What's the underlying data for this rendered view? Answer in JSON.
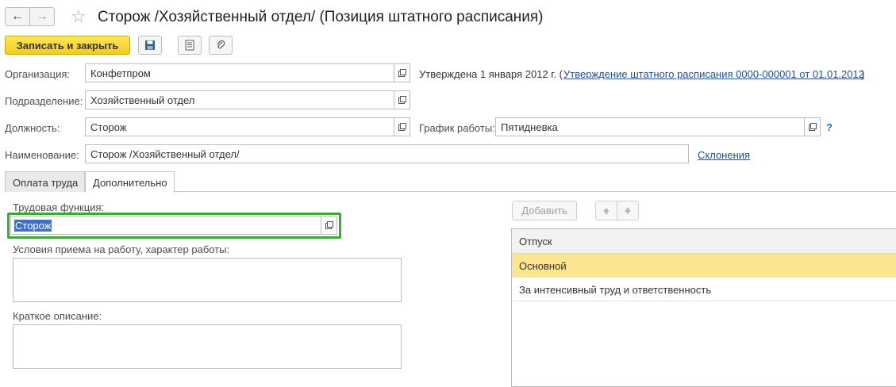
{
  "window": {
    "title": "Сторож /Хозяйственный отдел/ (Позиция штатного расписания)",
    "back_glyph": "←",
    "forward_glyph": "→",
    "star_glyph": "☆"
  },
  "toolbar": {
    "save_close_label": "Записать и закрыть"
  },
  "form": {
    "organization": {
      "label": "Организация:",
      "value": "Конфетпром"
    },
    "approved": {
      "text": "Утверждена 1 января 2012 г. (",
      "link": "Утверждение штатного расписания 0000-000001 от 01.01.2012",
      "close": ")"
    },
    "department": {
      "label": "Подразделение:",
      "value": "Хозяйственный отдел"
    },
    "position": {
      "label": "Должность:",
      "value": "Сторож"
    },
    "schedule": {
      "label": "График работы:",
      "value": "Пятидневка",
      "help": "?"
    },
    "name": {
      "label": "Наименование:",
      "value": "Сторож /Хозяйственный отдел/",
      "declension_link": "Склонения"
    }
  },
  "tabs": [
    {
      "label": "Оплата труда",
      "active": false
    },
    {
      "label": "Дополнительно",
      "active": true
    }
  ],
  "additional": {
    "labor_function": {
      "label": "Трудовая функция:",
      "value": "Сторож"
    },
    "conditions": {
      "label": "Условия приема на работу, характер работы:",
      "value": ""
    },
    "short_description": {
      "label": "Краткое описание:",
      "value": ""
    }
  },
  "vacation_table": {
    "add_label": "Добавить",
    "column": "Отпуск",
    "rows": [
      "Основной",
      "За интенсивный труд и ответственность"
    ]
  },
  "colors": {
    "accent_yellow": "#f3cc1c",
    "selected_row": "#fde58f",
    "highlight_border": "#3aaa35",
    "selected_text_bg": "#3f6fc4"
  }
}
